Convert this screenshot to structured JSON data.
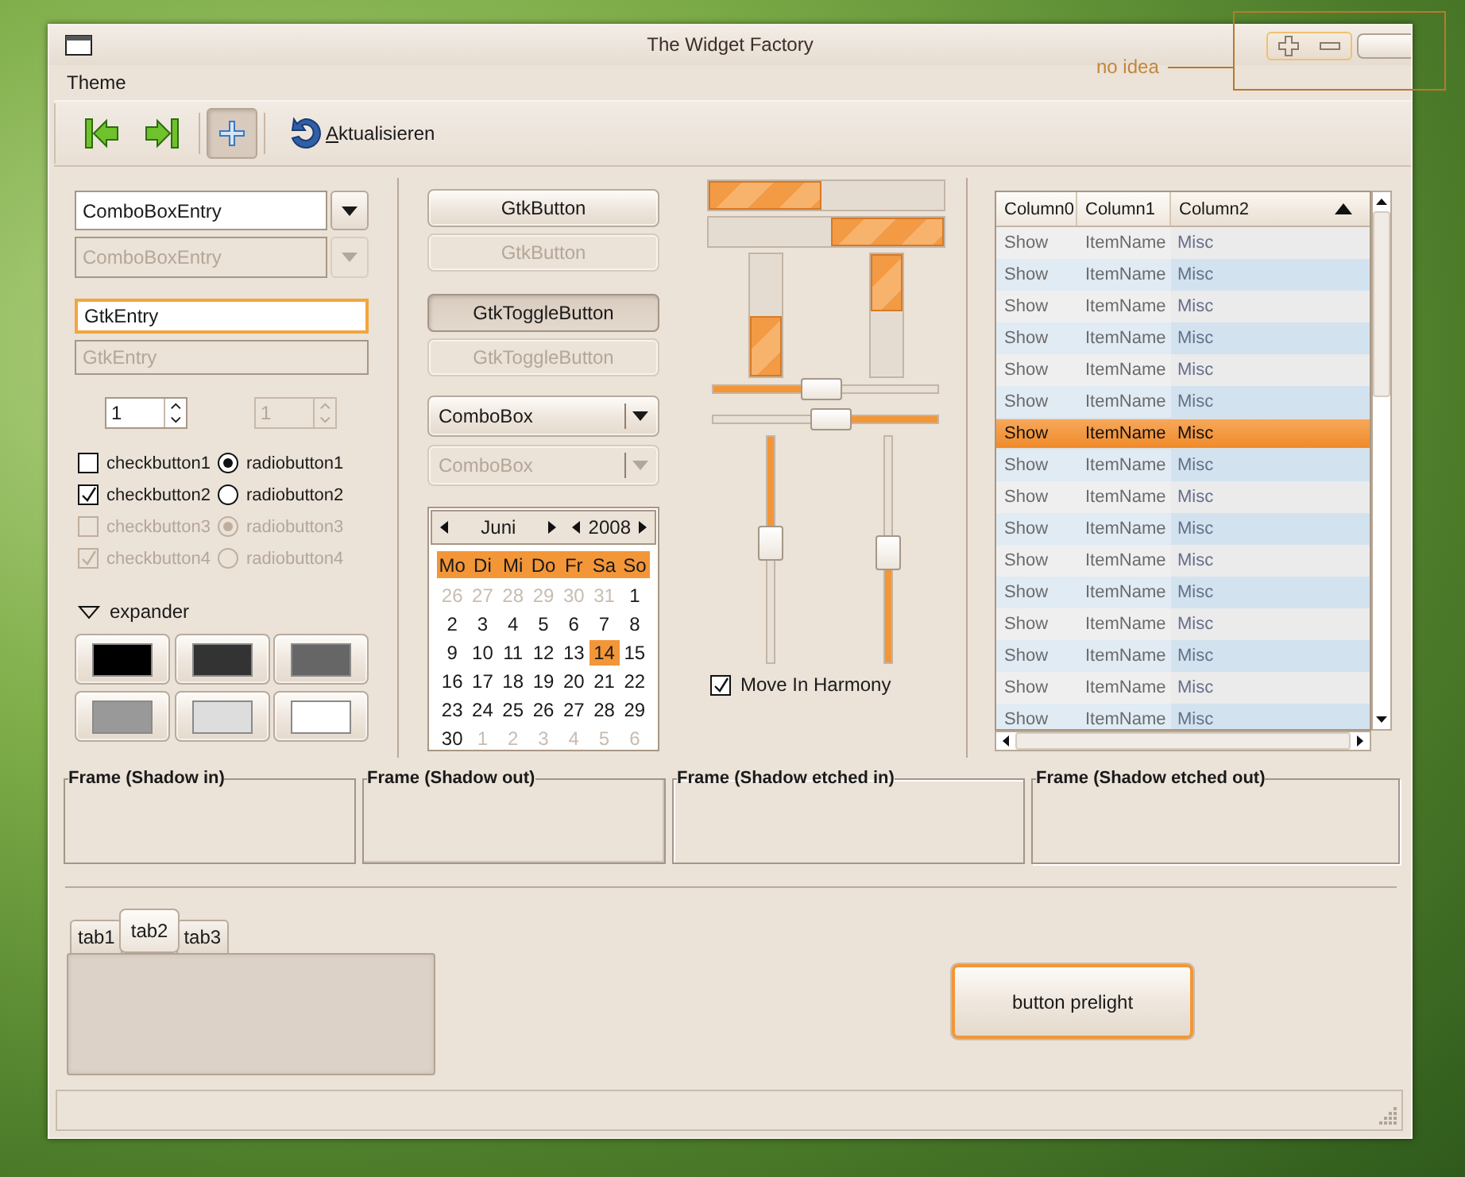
{
  "window": {
    "title": "The Widget Factory"
  },
  "annotation": {
    "text": "no idea"
  },
  "menubar": [
    {
      "label": "Theme"
    }
  ],
  "toolbar": [
    {
      "kind": "go-first"
    },
    {
      "kind": "go-last"
    },
    {
      "kind": "separator"
    },
    {
      "kind": "toggle",
      "active": true
    },
    {
      "kind": "separator"
    },
    {
      "kind": "refresh",
      "label": "Aktualisieren"
    }
  ],
  "combo_entries": [
    {
      "value": "ComboBoxEntry",
      "disabled": false
    },
    {
      "value": "ComboBoxEntry",
      "disabled": true
    }
  ],
  "entries": [
    {
      "value": "GtkEntry",
      "focused": true,
      "disabled": false
    },
    {
      "value": "GtkEntry",
      "focused": false,
      "disabled": true
    }
  ],
  "spin_buttons": [
    {
      "value": "1",
      "disabled": false
    },
    {
      "value": "1",
      "disabled": true
    }
  ],
  "check_buttons": [
    {
      "label": "checkbutton1",
      "checked": false,
      "disabled": false
    },
    {
      "label": "checkbutton2",
      "checked": true,
      "disabled": false
    },
    {
      "label": "checkbutton3",
      "checked": false,
      "disabled": true
    },
    {
      "label": "checkbutton4",
      "checked": true,
      "disabled": true
    }
  ],
  "radio_buttons": [
    {
      "label": "radiobutton1",
      "selected": true,
      "disabled": false
    },
    {
      "label": "radiobutton2",
      "selected": false,
      "disabled": false
    },
    {
      "label": "radiobutton3",
      "selected": true,
      "disabled": true
    },
    {
      "label": "radiobutton4",
      "selected": false,
      "disabled": true
    }
  ],
  "expander": {
    "label": "expander",
    "expanded": true
  },
  "color_buttons": [
    {
      "color": "#000000"
    },
    {
      "color": "#333333"
    },
    {
      "color": "#666666"
    },
    {
      "color": "#999999"
    },
    {
      "color": "#dddddd"
    },
    {
      "color": "#ffffff"
    }
  ],
  "buttons": [
    {
      "label": "GtkButton",
      "disabled": false
    },
    {
      "label": "GtkButton",
      "disabled": true
    }
  ],
  "toggle_buttons": [
    {
      "label": "GtkToggleButton",
      "active": true,
      "disabled": false
    },
    {
      "label": "GtkToggleButton",
      "active": false,
      "disabled": true
    }
  ],
  "combo_boxes": [
    {
      "value": "ComboBox",
      "disabled": false
    },
    {
      "value": "ComboBox",
      "disabled": true
    }
  ],
  "calendar": {
    "month": "Juni",
    "year": "2008",
    "weekdays": [
      "Mo",
      "Di",
      "Mi",
      "Do",
      "Fr",
      "Sa",
      "So"
    ],
    "days": [
      {
        "label": "26",
        "other_month": true,
        "selected": false
      },
      {
        "label": "27",
        "other_month": true,
        "selected": false
      },
      {
        "label": "28",
        "other_month": true,
        "selected": false
      },
      {
        "label": "29",
        "other_month": true,
        "selected": false
      },
      {
        "label": "30",
        "other_month": true,
        "selected": false
      },
      {
        "label": "31",
        "other_month": true,
        "selected": false
      },
      {
        "label": "1",
        "other_month": false,
        "selected": false
      },
      {
        "label": "2",
        "other_month": false,
        "selected": false
      },
      {
        "label": "3",
        "other_month": false,
        "selected": false
      },
      {
        "label": "4",
        "other_month": false,
        "selected": false
      },
      {
        "label": "5",
        "other_month": false,
        "selected": false
      },
      {
        "label": "6",
        "other_month": false,
        "selected": false
      },
      {
        "label": "7",
        "other_month": false,
        "selected": false
      },
      {
        "label": "8",
        "other_month": false,
        "selected": false
      },
      {
        "label": "9",
        "other_month": false,
        "selected": false
      },
      {
        "label": "10",
        "other_month": false,
        "selected": false
      },
      {
        "label": "11",
        "other_month": false,
        "selected": false
      },
      {
        "label": "12",
        "other_month": false,
        "selected": false
      },
      {
        "label": "13",
        "other_month": false,
        "selected": false
      },
      {
        "label": "14",
        "other_month": false,
        "selected": true
      },
      {
        "label": "15",
        "other_month": false,
        "selected": false
      },
      {
        "label": "16",
        "other_month": false,
        "selected": false
      },
      {
        "label": "17",
        "other_month": false,
        "selected": false
      },
      {
        "label": "18",
        "other_month": false,
        "selected": false
      },
      {
        "label": "19",
        "other_month": false,
        "selected": false
      },
      {
        "label": "20",
        "other_month": false,
        "selected": false
      },
      {
        "label": "21",
        "other_month": false,
        "selected": false
      },
      {
        "label": "22",
        "other_month": false,
        "selected": false
      },
      {
        "label": "23",
        "other_month": false,
        "selected": false
      },
      {
        "label": "24",
        "other_month": false,
        "selected": false
      },
      {
        "label": "25",
        "other_month": false,
        "selected": false
      },
      {
        "label": "26",
        "other_month": false,
        "selected": false
      },
      {
        "label": "27",
        "other_month": false,
        "selected": false
      },
      {
        "label": "28",
        "other_month": false,
        "selected": false
      },
      {
        "label": "29",
        "other_month": false,
        "selected": false
      },
      {
        "label": "30",
        "other_month": false,
        "selected": false
      },
      {
        "label": "1",
        "other_month": true,
        "selected": false
      },
      {
        "label": "2",
        "other_month": true,
        "selected": false
      },
      {
        "label": "3",
        "other_month": true,
        "selected": false
      },
      {
        "label": "4",
        "other_month": true,
        "selected": false
      },
      {
        "label": "5",
        "other_month": true,
        "selected": false
      },
      {
        "label": "6",
        "other_month": true,
        "selected": false
      }
    ]
  },
  "progress_bars": [
    {
      "vertical": false,
      "inverted": false,
      "level": 0.48
    },
    {
      "vertical": false,
      "inverted": true,
      "level": 0.48
    },
    {
      "vertical": true,
      "inverted": true,
      "level": 0.49
    },
    {
      "vertical": true,
      "inverted": false,
      "level": 0.47
    }
  ],
  "scales": [
    {
      "vertical": false,
      "inverted": false,
      "level": 0.48
    },
    {
      "vertical": false,
      "inverted": true,
      "level": 0.47
    },
    {
      "vertical": true,
      "inverted": false,
      "level": 0.47
    },
    {
      "vertical": true,
      "inverted": true,
      "level": 0.48
    }
  ],
  "harmony": {
    "label": "Move In Harmony",
    "checked": true
  },
  "tree": {
    "columns": [
      {
        "label": "Column0"
      },
      {
        "label": "Column1"
      },
      {
        "label": "Column2",
        "sorted": true
      }
    ],
    "rows": [
      {
        "cells": [
          "Show",
          "ItemName",
          "Misc"
        ],
        "selected": false
      },
      {
        "cells": [
          "Show",
          "ItemName",
          "Misc"
        ],
        "selected": false
      },
      {
        "cells": [
          "Show",
          "ItemName",
          "Misc"
        ],
        "selected": false
      },
      {
        "cells": [
          "Show",
          "ItemName",
          "Misc"
        ],
        "selected": false
      },
      {
        "cells": [
          "Show",
          "ItemName",
          "Misc"
        ],
        "selected": false
      },
      {
        "cells": [
          "Show",
          "ItemName",
          "Misc"
        ],
        "selected": false
      },
      {
        "cells": [
          "Show",
          "ItemName",
          "Misc"
        ],
        "selected": true
      },
      {
        "cells": [
          "Show",
          "ItemName",
          "Misc"
        ],
        "selected": false
      },
      {
        "cells": [
          "Show",
          "ItemName",
          "Misc"
        ],
        "selected": false
      },
      {
        "cells": [
          "Show",
          "ItemName",
          "Misc"
        ],
        "selected": false
      },
      {
        "cells": [
          "Show",
          "ItemName",
          "Misc"
        ],
        "selected": false
      },
      {
        "cells": [
          "Show",
          "ItemName",
          "Misc"
        ],
        "selected": false
      },
      {
        "cells": [
          "Show",
          "ItemName",
          "Misc"
        ],
        "selected": false
      },
      {
        "cells": [
          "Show",
          "ItemName",
          "Misc"
        ],
        "selected": false
      },
      {
        "cells": [
          "Show",
          "ItemName",
          "Misc"
        ],
        "selected": false
      },
      {
        "cells": [
          "Show",
          "ItemName",
          "Misc"
        ],
        "selected": false
      }
    ]
  },
  "frames": [
    {
      "label": "Frame (Shadow in)",
      "kind": "shadow-in"
    },
    {
      "label": "Frame (Shadow out)",
      "kind": "shadow-out"
    },
    {
      "label": "Frame (Shadow etched in)",
      "kind": "etched-in"
    },
    {
      "label": "Frame (Shadow etched out)",
      "kind": "etched-out"
    }
  ],
  "notebook": {
    "tabs": [
      {
        "label": "tab1",
        "selected": false
      },
      {
        "label": "tab2",
        "selected": true
      },
      {
        "label": "tab3",
        "selected": false
      }
    ]
  },
  "prelight_button": {
    "label": "button prelight",
    "prelight": true
  }
}
